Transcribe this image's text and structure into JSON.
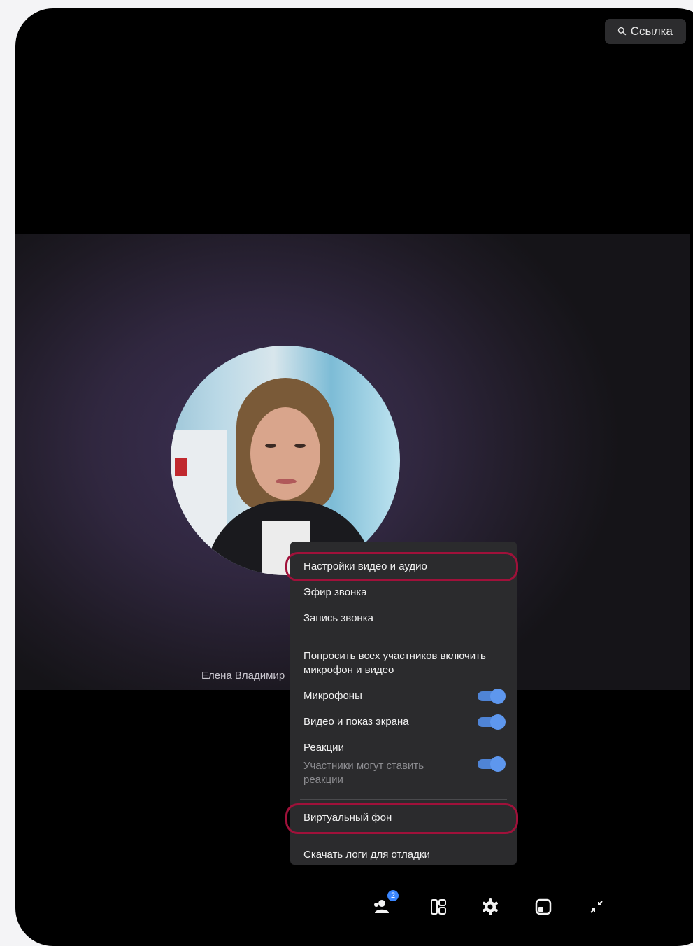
{
  "header": {
    "link_label": "Ссылка",
    "link_icon": "link-icon"
  },
  "participant": {
    "name": "Елена Владимир"
  },
  "menu": {
    "items": [
      {
        "label": "Настройки видео и аудио"
      },
      {
        "label": "Эфир звонка"
      },
      {
        "label": "Запись звонка"
      },
      {
        "label": "Попросить всех участников включить микрофон и видео"
      },
      {
        "label": "Микрофоны",
        "toggle": true
      },
      {
        "label": "Видео и показ экрана",
        "toggle": true
      },
      {
        "label": "Реакции",
        "sublabel": "Участники могут ставить реакции",
        "toggle": true
      },
      {
        "label": "Виртуальный фон"
      },
      {
        "label": "Скачать логи для отладки"
      }
    ]
  },
  "toolbar": {
    "participants_count": "2",
    "icons": [
      "participants-icon",
      "layout-icon",
      "settings-icon",
      "pip-icon",
      "minimize-icon"
    ]
  },
  "colors": {
    "highlight": "#a0113a",
    "toggle": "#5e97ee",
    "menu_bg": "#2b2b2d"
  }
}
